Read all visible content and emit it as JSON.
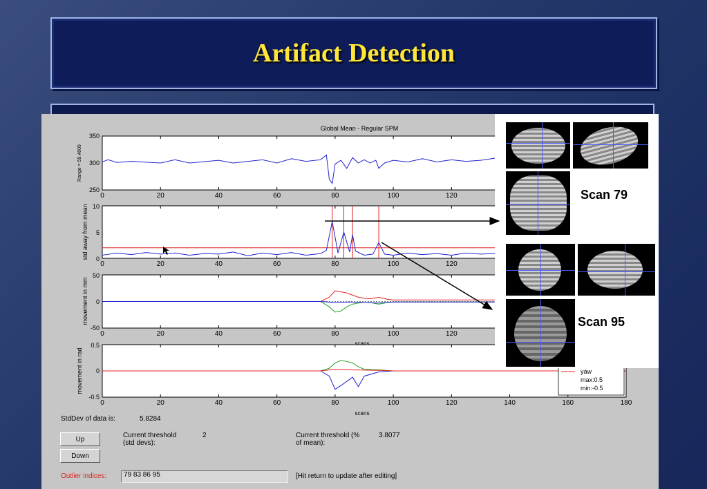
{
  "slide": {
    "title": "Artifact Detection"
  },
  "plots": {
    "p1": {
      "title": "Global Mean - Regular SPM",
      "ylabel": "Range = 59.4609",
      "yticks": [
        "350",
        "300",
        "250"
      ]
    },
    "p2": {
      "ylabel": "std away from mean",
      "yticks": [
        "10",
        "5",
        "0"
      ]
    },
    "p3": {
      "ylabel": "movement in mm",
      "yticks": [
        "50",
        "0",
        "-50"
      ],
      "xlabel": "scans"
    },
    "p4": {
      "ylabel": "movement in rad",
      "yticks": [
        "0.5",
        "0",
        "-0.5"
      ],
      "xlabel": "scans"
    },
    "xticks_short": [
      "0",
      "20",
      "40",
      "60",
      "80",
      "100",
      "120"
    ],
    "xticks_full": [
      "0",
      "20",
      "40",
      "60",
      "80",
      "100",
      "120",
      "140",
      "160",
      "180"
    ]
  },
  "legend": {
    "entry": "yaw",
    "max": "max:0.5",
    "min": "min:-0.5"
  },
  "chart_data": [
    {
      "type": "line",
      "title": "Global Mean - Regular SPM",
      "ylabel": "Range = 59.4609",
      "ylim": [
        250,
        350
      ],
      "xlim": [
        0,
        180
      ],
      "series": [
        {
          "color": "#2020d0",
          "x": [
            0,
            2,
            5,
            10,
            20,
            25,
            30,
            40,
            45,
            55,
            60,
            65,
            70,
            75,
            77,
            78,
            79,
            80,
            82,
            84,
            86,
            88,
            90,
            92,
            94,
            95,
            97,
            100,
            105,
            110,
            115,
            120,
            125,
            130,
            135
          ],
          "y": [
            302,
            306,
            301,
            303,
            300,
            306,
            300,
            305,
            300,
            306,
            300,
            308,
            303,
            306,
            315,
            270,
            262,
            298,
            305,
            290,
            310,
            300,
            306,
            300,
            305,
            290,
            300,
            305,
            302,
            308,
            302,
            306,
            303,
            305,
            309
          ]
        }
      ]
    },
    {
      "type": "line",
      "ylabel": "std away from mean",
      "ylim": [
        0,
        10
      ],
      "xlim": [
        0,
        180
      ],
      "threshold": 2,
      "outliers": [
        79,
        83,
        86,
        95
      ],
      "series": [
        {
          "color": "#2020d0",
          "x": [
            0,
            5,
            10,
            15,
            20,
            25,
            30,
            35,
            40,
            45,
            50,
            55,
            60,
            65,
            70,
            75,
            77,
            79,
            81,
            83,
            85,
            86,
            87,
            90,
            93,
            95,
            97,
            100,
            105,
            110,
            115,
            120,
            125,
            130,
            135
          ],
          "y": [
            0.6,
            1.0,
            0.7,
            1.1,
            0.8,
            1.0,
            0.6,
            0.9,
            0.8,
            1.2,
            0.5,
            1.0,
            0.7,
            1.1,
            0.6,
            0.9,
            1.5,
            7.0,
            1.0,
            5.0,
            1.2,
            4.5,
            1.4,
            0.6,
            0.8,
            3.0,
            0.8,
            0.6,
            1.0,
            0.7,
            0.9,
            0.6,
            1.0,
            0.8,
            0.9
          ]
        }
      ]
    },
    {
      "type": "line",
      "ylabel": "movement in mm",
      "xlabel": "scans",
      "ylim": [
        -50,
        50
      ],
      "xlim": [
        0,
        180
      ],
      "series": [
        {
          "color": "#e02020",
          "x": [
            0,
            75,
            78,
            80,
            82,
            84,
            86,
            88,
            90,
            92,
            95,
            98,
            100,
            120,
            135
          ],
          "y": [
            0,
            0,
            8,
            20,
            18,
            16,
            12,
            8,
            6,
            5,
            8,
            4,
            3,
            3,
            3
          ]
        },
        {
          "color": "#20a020",
          "x": [
            0,
            75,
            78,
            80,
            82,
            84,
            86,
            88,
            90,
            92,
            95,
            98,
            100,
            120,
            135
          ],
          "y": [
            0,
            0,
            -10,
            -20,
            -18,
            -10,
            -5,
            -3,
            -2,
            -2,
            -5,
            -2,
            -1,
            -1,
            -1
          ]
        },
        {
          "color": "#2020d0",
          "x": [
            0,
            75,
            80,
            85,
            95,
            100,
            135
          ],
          "y": [
            0,
            0,
            -2,
            -1,
            -3,
            -1,
            -1
          ]
        }
      ]
    },
    {
      "type": "line",
      "ylabel": "movement in rad",
      "xlabel": "scans",
      "ylim": [
        -0.5,
        0.5
      ],
      "xlim": [
        0,
        180
      ],
      "series": [
        {
          "color": "#2020d0",
          "x": [
            0,
            75,
            78,
            80,
            82,
            84,
            86,
            88,
            90,
            95,
            100,
            180
          ],
          "y": [
            0,
            0,
            -0.1,
            -0.35,
            -0.28,
            -0.2,
            -0.12,
            -0.3,
            -0.1,
            -0.02,
            0,
            0
          ]
        },
        {
          "color": "#20a020",
          "x": [
            0,
            75,
            78,
            80,
            82,
            84,
            86,
            88,
            90,
            95,
            100,
            180
          ],
          "y": [
            0,
            0,
            0.05,
            0.15,
            0.2,
            0.18,
            0.15,
            0.08,
            0.03,
            0.02,
            0,
            0
          ]
        },
        {
          "color": "#e02020",
          "x": [
            0,
            75,
            80,
            85,
            95,
            100,
            180
          ],
          "y": [
            0,
            0,
            0.03,
            0.02,
            0.01,
            0,
            0
          ]
        }
      ]
    }
  ],
  "controls": {
    "stddev_label": "StdDev of data is:",
    "stddev_value": "5.8284",
    "up_button": "Up",
    "down_button": "Down",
    "thresh_std_label": "Current threshold\n(std devs):",
    "thresh_std_value": "2",
    "thresh_pct_label": "Current threshold (%\nof mean):",
    "thresh_pct_value": "3.8077",
    "outlier_label": "Outlier indices:",
    "outlier_value": "79  83  86  95",
    "hint": "[Hit return to update after editing]"
  },
  "scans": {
    "scan_a": "Scan 79",
    "scan_b": "Scan 95"
  },
  "colors": {
    "title_text": "#ffe63a",
    "title_bg": "#0e1d5a",
    "gui_bg": "#c6c6c6",
    "outlier_label": "#e02020"
  }
}
